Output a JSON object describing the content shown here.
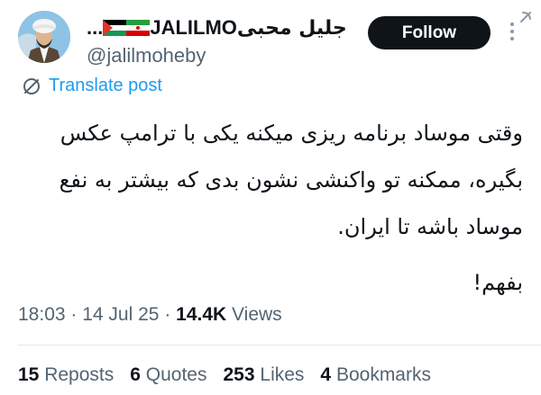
{
  "author": {
    "name_farsi": "جلیل محبی",
    "name_latin": "JALILMO",
    "name_flags": [
      "iran-flag",
      "palestine-flag"
    ],
    "ellipsis": "...",
    "handle": "@jalilmoheby"
  },
  "header": {
    "follow_label": "Follow"
  },
  "translate": {
    "label": "Translate post"
  },
  "tweet": {
    "lines": [
      "وقتی موساد برنامه ریزی میکنه یکی با ترامپ عکس",
      "بگیره، ممکنه تو واکنشی نشون بدی که بیشتر به نفع",
      "موساد باشه تا ایران.",
      "بفهم!"
    ]
  },
  "meta": {
    "time": "18:03",
    "date": "14 Jul 25",
    "views_count": "14.4K",
    "views_label": "Views"
  },
  "stats": {
    "reposts_count": "15",
    "reposts_label": "Reposts",
    "quotes_count": "6",
    "quotes_label": "Quotes",
    "likes_count": "253",
    "likes_label": "Likes",
    "bookmarks_count": "4",
    "bookmarks_label": "Bookmarks"
  },
  "colors": {
    "link_blue": "#1d9bf0",
    "secondary_text": "#536471",
    "primary_text": "#0f1419"
  }
}
